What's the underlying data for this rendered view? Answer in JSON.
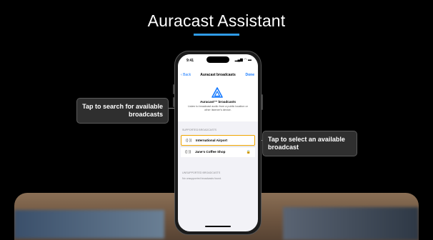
{
  "title": "Auracast Assistant",
  "callouts": {
    "left": "Tap to search for available broadcasts",
    "right": "Tap to select an available broadcast"
  },
  "phone": {
    "status_time": "9:41",
    "status_icons": "▂▄▆ ◠ ▬",
    "nav": {
      "back": "Back",
      "title": "Auracast broadcasts",
      "done": "Done"
    },
    "header": {
      "logo_icon": "auracast-logo-icon",
      "title": "Auracast™ broadcasts",
      "description": "Listen to broadcast audio from a public location or other listener's device."
    },
    "supported_label": "SUPPORTED BROADCASTS",
    "broadcasts": [
      {
        "name": "International Airport",
        "icon": "broadcast-icon",
        "locked": false
      },
      {
        "name": "Jane's Coffee Shop",
        "icon": "broadcast-icon",
        "locked": true
      }
    ],
    "unsupported_label": "UNSUPPORTED BROADCASTS",
    "unsupported_empty": "No unsupported broadcasts found."
  },
  "colors": {
    "accent": "#2f9be6",
    "highlight": "#f0a500",
    "ios_blue": "#1479ff"
  }
}
